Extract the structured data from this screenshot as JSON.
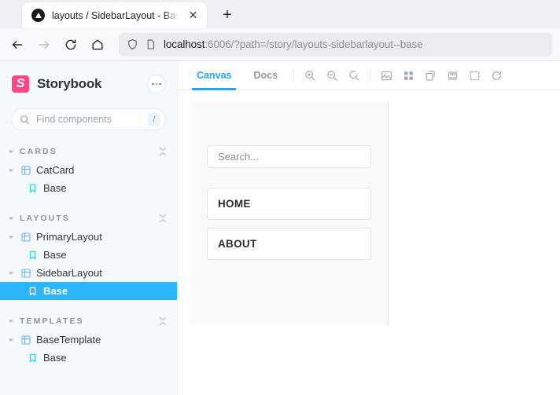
{
  "browser": {
    "tab": {
      "title": "layouts / SidebarLayout - Base",
      "favicon": "storybook-favicon",
      "close_label": "✕"
    },
    "new_tab_label": "+",
    "nav": {
      "back": "back-arrow",
      "forward": "forward-arrow",
      "reload": "reload",
      "home": "home"
    },
    "url": {
      "scheme_host": "localhost",
      "rest": ":6006/?path=/story/layouts-sidebarlayout--base"
    }
  },
  "storybook": {
    "brand": {
      "logo_letter": "S",
      "name": "Storybook",
      "logo_color": "#FF4785"
    },
    "search": {
      "placeholder": "Find components",
      "shortcut": "/"
    },
    "tree": [
      {
        "group": "CARDS",
        "items": [
          {
            "type": "component",
            "label": "CatCard",
            "depth": 0
          },
          {
            "type": "story",
            "label": "Base",
            "depth": 1,
            "selected": false
          }
        ]
      },
      {
        "group": "LAYOUTS",
        "items": [
          {
            "type": "component",
            "label": "PrimaryLayout",
            "depth": 0
          },
          {
            "type": "story",
            "label": "Base",
            "depth": 1,
            "selected": false
          },
          {
            "type": "component",
            "label": "SidebarLayout",
            "depth": 0
          },
          {
            "type": "story",
            "label": "Base",
            "depth": 1,
            "selected": true
          }
        ]
      },
      {
        "group": "TEMPLATES",
        "items": [
          {
            "type": "component",
            "label": "BaseTemplate",
            "depth": 0
          },
          {
            "type": "story",
            "label": "Base",
            "depth": 1,
            "selected": false
          }
        ]
      }
    ],
    "toolbar": {
      "tabs": [
        {
          "label": "Canvas",
          "active": true
        },
        {
          "label": "Docs",
          "active": false
        }
      ],
      "buttons": [
        "zoom-in-icon",
        "zoom-out-icon",
        "zoom-reset-icon",
        "backgrounds-icon",
        "grid-icon",
        "theme-icon",
        "measure-icon",
        "outline-icon",
        "refresh-icon"
      ]
    },
    "selected_color": "#29B6FB",
    "accent_color": "#1EA7FD"
  },
  "story_preview": {
    "search_placeholder": "Search...",
    "nav": [
      {
        "label": "HOME"
      },
      {
        "label": "ABOUT"
      }
    ]
  }
}
